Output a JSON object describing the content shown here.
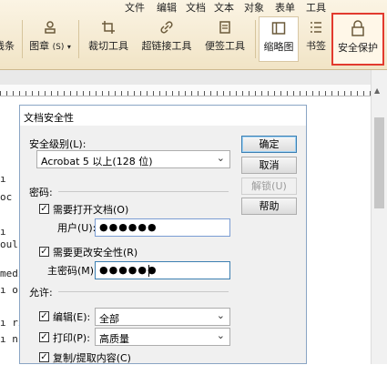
{
  "menu": [
    "文件",
    "编辑",
    "文档",
    "文本",
    "对象",
    "表单",
    "工具"
  ],
  "toolbar": {
    "line_label": "线条",
    "stamp_label": "图章",
    "stamp_suffix": "(S)",
    "crop_label": "裁切工具",
    "link_label": "超链接工具",
    "note_label": "便签工具",
    "thumbnail_label": "缩略图",
    "bookmark_label": "书签",
    "security_label": "安全保护"
  },
  "document": {
    "lines": [
      "ı",
      "oc",
      "ı",
      "oul",
      "medi",
      "ı os",
      "ı ri",
      "ı nc"
    ]
  },
  "dialog": {
    "title": "文档安全性",
    "security_level_label": "安全级别(L):",
    "security_level_value": "Acrobat 5 以上(128 位)",
    "password_section": "密码:",
    "require_open_label": "需要打开文档(O)",
    "require_open_checked": true,
    "user_pwd_label": "用户(U):",
    "user_pwd_value": "●●●●●●",
    "require_change_label": "需要更改安全性(R)",
    "require_change_checked": true,
    "master_pwd_label": "主密码(M):",
    "master_pwd_value": "●●●●●●",
    "permissions_section": "允许:",
    "edit_label": "编辑(E):",
    "edit_checked": true,
    "edit_value": "全部",
    "print_label": "打印(P):",
    "print_checked": true,
    "print_value": "高质量",
    "copy_label": "复制/提取内容(C)",
    "copy_checked": true,
    "ok_label": "确定",
    "cancel_label": "取消",
    "unlock_label": "解锁(U)",
    "help_label": "帮助"
  },
  "colors": {
    "highlight": "#e23a2e",
    "ribbon": "#f1e4c6"
  }
}
